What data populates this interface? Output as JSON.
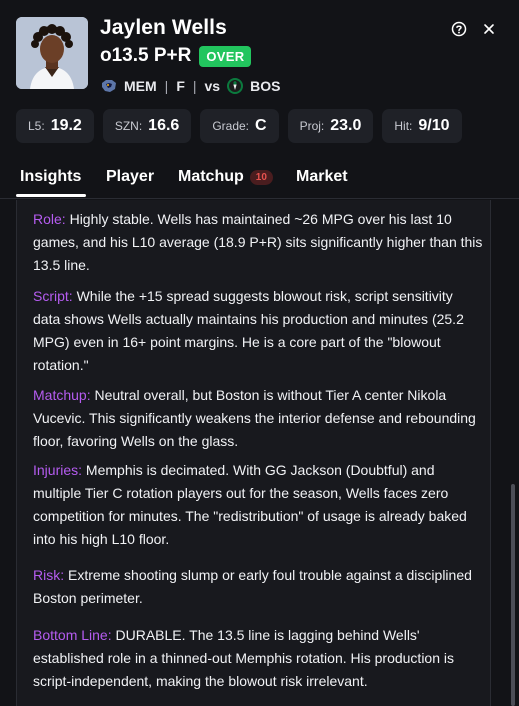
{
  "player": {
    "name": "Jaylen Wells",
    "line": "o13.5 P+R",
    "badge": "OVER",
    "team": "MEM",
    "position": "F",
    "vs_label": "vs",
    "opponent": "BOS"
  },
  "icons": {
    "help": "question-circle-icon",
    "close": "close-icon",
    "team_logo": "grizzlies-logo",
    "opponent_logo": "celtics-logo"
  },
  "stats": [
    {
      "label": "L5:",
      "value": "19.2"
    },
    {
      "label": "SZN:",
      "value": "16.6"
    },
    {
      "label": "Grade:",
      "value": "C"
    },
    {
      "label": "Proj:",
      "value": "23.0"
    },
    {
      "label": "Hit:",
      "value": "9/10"
    }
  ],
  "tabs": [
    {
      "label": "Insights"
    },
    {
      "label": "Player"
    },
    {
      "label": "Matchup",
      "count": "10"
    },
    {
      "label": "Market"
    }
  ],
  "insights": {
    "role": {
      "label": "Role:",
      "text": " Highly stable. Wells has maintained ~26 MPG over his last 10 games, and his L10 average (18.9 P+R) sits significantly higher than this 13.5 line."
    },
    "script": {
      "label": "Script:",
      "text": " While the +15 spread suggests blowout risk, script sensitivity data shows Wells actually maintains his production and minutes (25.2 MPG) even in 16+ point margins. He is a core part of the \"blowout rotation.\""
    },
    "matchup": {
      "label": "Matchup:",
      "text": " Neutral overall, but Boston is without Tier A center Nikola Vucevic. This significantly weakens the interior defense and rebounding floor, favoring Wells on the glass."
    },
    "injuries": {
      "label": "Injuries:",
      "text": " Memphis is decimated. With GG Jackson (Doubtful) and multiple Tier C rotation players out for the season, Wells faces zero competition for minutes. The \"redistribution\" of usage is already baked into his high L10 floor."
    },
    "risk": {
      "label": "Risk:",
      "text": " Extreme shooting slump or early foul trouble against a disciplined Boston perimeter."
    },
    "bottom_line": {
      "label": "Bottom Line:",
      "text": " DURABLE. The 13.5 line is lagging behind Wells' established role in a thinned-out Memphis rotation. His production is script-independent, making the blowout risk irrelevant."
    }
  },
  "colors": {
    "background": "#121317",
    "accent_label": "#b55cf0",
    "over_badge": "#22c55e",
    "count_badge_text": "#e7524f"
  }
}
